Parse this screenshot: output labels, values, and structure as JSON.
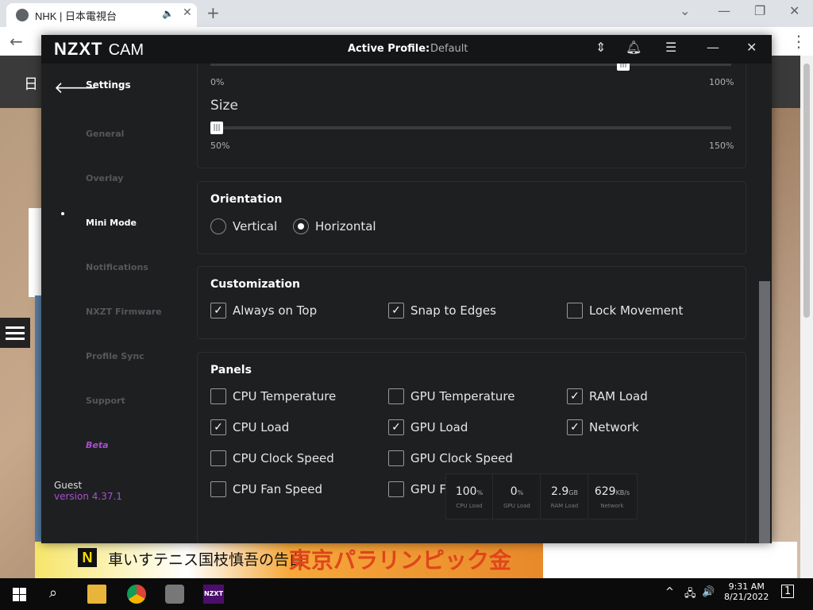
{
  "browser": {
    "tab_title": "NHK | 日本電視台",
    "audio_icon": "speaker-icon",
    "close_glyph": "✕",
    "new_tab_glyph": "+"
  },
  "webpage": {
    "header_glyph": "日",
    "news_logo": "N",
    "subtitle": "車いすテニス国枝慎吾の告白",
    "headline": "東京パラリンピック金"
  },
  "app": {
    "logo_main": "NZXT",
    "logo_sub": "CAM",
    "active_profile_label": "Active Profile:",
    "active_profile_value": "Default",
    "sidebar": {
      "title": "Settings",
      "items": [
        {
          "label": "General",
          "active": false
        },
        {
          "label": "Overlay",
          "active": false
        },
        {
          "label": "Mini Mode",
          "active": true
        },
        {
          "label": "Notifications",
          "active": false
        },
        {
          "label": "NXZT Firmware",
          "active": false
        },
        {
          "label": "Profile Sync",
          "active": false
        },
        {
          "label": "Support",
          "active": false
        },
        {
          "label": "Beta",
          "active": false
        }
      ],
      "user": "Guest",
      "version": "version 4.37.1"
    },
    "opacity_slider": {
      "min_label": "0%",
      "max_label": "100%",
      "value_fraction": 0.8
    },
    "size_slider": {
      "title": "Size",
      "min_label": "50%",
      "max_label": "150%",
      "value_fraction": 0.0
    },
    "orientation": {
      "title": "Orientation",
      "options": [
        {
          "label": "Vertical",
          "selected": false
        },
        {
          "label": "Horizontal",
          "selected": true
        }
      ]
    },
    "customization": {
      "title": "Customization",
      "options": [
        {
          "label": "Always on Top",
          "checked": true
        },
        {
          "label": "Snap to Edges",
          "checked": true
        },
        {
          "label": "Lock Movement",
          "checked": false
        }
      ]
    },
    "panels": {
      "title": "Panels",
      "options": [
        {
          "label": "CPU Temperature",
          "checked": false
        },
        {
          "label": "GPU Temperature",
          "checked": false
        },
        {
          "label": "RAM Load",
          "checked": true
        },
        {
          "label": "CPU Load",
          "checked": true
        },
        {
          "label": "GPU Load",
          "checked": true
        },
        {
          "label": "Network",
          "checked": true
        },
        {
          "label": "CPU Clock Speed",
          "checked": false
        },
        {
          "label": "GPU Clock Speed",
          "checked": false
        },
        {
          "label": "CPU Fan Speed",
          "checked": false
        },
        {
          "label": "GPU Fan Speed",
          "checked": false
        }
      ]
    },
    "mini_widget": [
      {
        "value": "100",
        "unit": "%",
        "label": "CPU Load"
      },
      {
        "value": "0",
        "unit": "%",
        "label": "GPU Load"
      },
      {
        "value": "2.9",
        "unit": "GB",
        "label": "RAM Load"
      },
      {
        "value": "629",
        "unit": "KB/s",
        "label": "Network"
      }
    ]
  },
  "taskbar": {
    "time": "9:31 AM",
    "date": "8/21/2022",
    "notification_count": "1",
    "nzxt_label": "NZXT"
  },
  "colors": {
    "accent_purple": "#a84fd0",
    "app_bg": "#1e1f21"
  }
}
